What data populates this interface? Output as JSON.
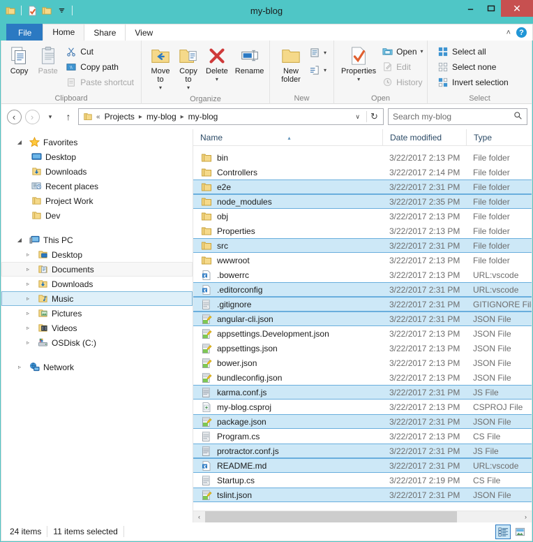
{
  "window": {
    "title": "my-blog",
    "minimize_label": "–",
    "maximize_label": "□",
    "close_label": "✕"
  },
  "quick_access": {
    "items": [
      {
        "name": "folder-icon",
        "label": ""
      },
      {
        "name": "properties-icon",
        "label": ""
      },
      {
        "name": "new-folder-icon",
        "label": ""
      },
      {
        "name": "chevron-down-icon",
        "label": ""
      }
    ]
  },
  "tabs": [
    {
      "label": "File",
      "id": "file"
    },
    {
      "label": "Home",
      "id": "home"
    },
    {
      "label": "Share",
      "id": "share"
    },
    {
      "label": "View",
      "id": "view"
    }
  ],
  "ribbon": {
    "collapse_label": "˄",
    "help_label": "?",
    "groups": [
      {
        "label": "Clipboard",
        "big": [
          {
            "label": "Copy",
            "icon": "copy-icon",
            "disabled": false
          },
          {
            "label": "Paste",
            "icon": "paste-icon",
            "disabled": true
          }
        ],
        "small": [
          {
            "label": "Cut",
            "icon": "cut-icon",
            "disabled": false
          },
          {
            "label": "Copy path",
            "icon": "copy-path-icon",
            "disabled": false
          },
          {
            "label": "Paste shortcut",
            "icon": "paste-shortcut-icon",
            "disabled": true
          }
        ]
      },
      {
        "label": "Organize",
        "big": [
          {
            "label": "Move to",
            "icon": "move-to-icon",
            "dropdown": true
          },
          {
            "label": "Copy to",
            "icon": "copy-to-icon",
            "dropdown": true
          },
          {
            "label": "Delete",
            "icon": "delete-icon",
            "dropdown": true
          },
          {
            "label": "Rename",
            "icon": "rename-icon",
            "dropdown": false
          }
        ],
        "small": []
      },
      {
        "label": "New",
        "big": [
          {
            "label": "New folder",
            "icon": "new-folder-icon",
            "dropdown": false
          }
        ],
        "small": [
          {
            "label": "",
            "icon": "new-item-icon",
            "dropdown": true
          },
          {
            "label": "",
            "icon": "easy-access-icon",
            "dropdown": true
          }
        ]
      },
      {
        "label": "Open",
        "big": [
          {
            "label": "Properties",
            "icon": "properties-icon",
            "dropdown": true
          }
        ],
        "small": [
          {
            "label": "Open",
            "icon": "open-icon",
            "disabled": false,
            "dropdown": true
          },
          {
            "label": "Edit",
            "icon": "edit-icon",
            "disabled": true
          },
          {
            "label": "History",
            "icon": "history-icon",
            "disabled": true
          }
        ]
      },
      {
        "label": "Select",
        "big": [],
        "small": [
          {
            "label": "Select all",
            "icon": "select-all-icon",
            "disabled": false
          },
          {
            "label": "Select none",
            "icon": "select-none-icon",
            "disabled": false
          },
          {
            "label": "Invert selection",
            "icon": "invert-selection-icon",
            "disabled": false
          }
        ]
      }
    ]
  },
  "address": {
    "back_label": "‹",
    "forward_label": "›",
    "recent_label": "▾",
    "up_label": "↑",
    "prefix": "«",
    "crumbs": [
      "Projects",
      "my-blog",
      "my-blog"
    ],
    "separator": "▸",
    "dropdown_label": "∨",
    "refresh_label": "↻"
  },
  "search": {
    "placeholder": "Search my-blog",
    "value": "",
    "icon_label": "⌕"
  },
  "sidebar": {
    "sections": [
      {
        "name": "favorites",
        "root": {
          "label": "Favorites",
          "icon": "star-icon",
          "expander": "◢",
          "state": "expanded",
          "selected": false,
          "hover": false
        },
        "children": [
          {
            "label": "Desktop",
            "icon": "desktop-icon",
            "expander": "",
            "selected": false,
            "hover": false
          },
          {
            "label": "Downloads",
            "icon": "downloads-icon",
            "expander": "",
            "selected": false,
            "hover": false
          },
          {
            "label": "Recent places",
            "icon": "recent-places-icon",
            "expander": "",
            "selected": false,
            "hover": false
          },
          {
            "label": "Project Work",
            "icon": "folder-icon",
            "expander": "",
            "selected": false,
            "hover": false
          },
          {
            "label": "Dev",
            "icon": "folder-icon",
            "expander": "",
            "selected": false,
            "hover": false
          }
        ]
      },
      {
        "name": "this-pc",
        "root": {
          "label": "This PC",
          "icon": "this-pc-icon",
          "expander": "◢",
          "state": "expanded",
          "selected": false,
          "hover": false
        },
        "children": [
          {
            "label": "Desktop",
            "icon": "desktop-folder-icon",
            "expander": "▹",
            "selected": false,
            "hover": false
          },
          {
            "label": "Documents",
            "icon": "documents-icon",
            "expander": "▹",
            "selected": false,
            "hover": true
          },
          {
            "label": "Downloads",
            "icon": "downloads-icon",
            "expander": "▹",
            "selected": false,
            "hover": false
          },
          {
            "label": "Music",
            "icon": "music-icon",
            "expander": "▹",
            "selected": true,
            "hover": false
          },
          {
            "label": "Pictures",
            "icon": "pictures-icon",
            "expander": "▹",
            "selected": false,
            "hover": false
          },
          {
            "label": "Videos",
            "icon": "videos-icon",
            "expander": "▹",
            "selected": false,
            "hover": false
          },
          {
            "label": "OSDisk (C:)",
            "icon": "drive-icon",
            "expander": "▹",
            "selected": false,
            "hover": false
          }
        ]
      },
      {
        "name": "network",
        "root": {
          "label": "Network",
          "icon": "network-icon",
          "expander": "▹",
          "state": "collapsed",
          "selected": false,
          "hover": false
        },
        "children": []
      }
    ]
  },
  "filelist": {
    "columns": [
      {
        "label": "Name",
        "sorted": true,
        "sort_dir": "asc",
        "sort_glyph": "▴"
      },
      {
        "label": "Date modified",
        "sorted": false
      },
      {
        "label": "Type",
        "sorted": false
      }
    ],
    "rows": [
      {
        "name": "bin",
        "date": "3/22/2017 2:13 PM",
        "type": "File folder",
        "icon": "folder-icon",
        "selected": false
      },
      {
        "name": "Controllers",
        "date": "3/22/2017 2:14 PM",
        "type": "File folder",
        "icon": "folder-icon",
        "selected": false
      },
      {
        "name": "e2e",
        "date": "3/22/2017 2:31 PM",
        "type": "File folder",
        "icon": "folder-icon",
        "selected": true
      },
      {
        "name": "node_modules",
        "date": "3/22/2017 2:35 PM",
        "type": "File folder",
        "icon": "folder-icon",
        "selected": true
      },
      {
        "name": "obj",
        "date": "3/22/2017 2:13 PM",
        "type": "File folder",
        "icon": "folder-icon",
        "selected": false
      },
      {
        "name": "Properties",
        "date": "3/22/2017 2:13 PM",
        "type": "File folder",
        "icon": "folder-icon",
        "selected": false
      },
      {
        "name": "src",
        "date": "3/22/2017 2:31 PM",
        "type": "File folder",
        "icon": "folder-icon",
        "selected": true
      },
      {
        "name": "wwwroot",
        "date": "3/22/2017 2:13 PM",
        "type": "File folder",
        "icon": "folder-icon",
        "selected": false
      },
      {
        "name": ".bowerrc",
        "date": "3/22/2017 2:13 PM",
        "type": "URL:vscode",
        "icon": "vscode-file-icon",
        "selected": false
      },
      {
        "name": ".editorconfig",
        "date": "3/22/2017 2:31 PM",
        "type": "URL:vscode",
        "icon": "vscode-file-icon",
        "selected": true
      },
      {
        "name": ".gitignore",
        "date": "3/22/2017 2:31 PM",
        "type": "GITIGNORE File",
        "icon": "text-file-icon",
        "selected": true
      },
      {
        "name": "angular-cli.json",
        "date": "3/22/2017 2:31 PM",
        "type": "JSON File",
        "icon": "json-file-icon",
        "selected": true
      },
      {
        "name": "appsettings.Development.json",
        "date": "3/22/2017 2:13 PM",
        "type": "JSON File",
        "icon": "json-file-icon",
        "selected": false
      },
      {
        "name": "appsettings.json",
        "date": "3/22/2017 2:13 PM",
        "type": "JSON File",
        "icon": "json-file-icon",
        "selected": false
      },
      {
        "name": "bower.json",
        "date": "3/22/2017 2:13 PM",
        "type": "JSON File",
        "icon": "json-file-icon",
        "selected": false
      },
      {
        "name": "bundleconfig.json",
        "date": "3/22/2017 2:13 PM",
        "type": "JSON File",
        "icon": "json-file-icon",
        "selected": false
      },
      {
        "name": "karma.conf.js",
        "date": "3/22/2017 2:31 PM",
        "type": "JS File",
        "icon": "js-file-icon",
        "selected": true
      },
      {
        "name": "my-blog.csproj",
        "date": "3/22/2017 2:13 PM",
        "type": "CSPROJ File",
        "icon": "csproj-file-icon",
        "selected": false
      },
      {
        "name": "package.json",
        "date": "3/22/2017 2:31 PM",
        "type": "JSON File",
        "icon": "json-file-icon",
        "selected": true
      },
      {
        "name": "Program.cs",
        "date": "3/22/2017 2:13 PM",
        "type": "CS File",
        "icon": "text-file-icon",
        "selected": false
      },
      {
        "name": "protractor.conf.js",
        "date": "3/22/2017 2:31 PM",
        "type": "JS File",
        "icon": "js-file-icon",
        "selected": true
      },
      {
        "name": "README.md",
        "date": "3/22/2017 2:31 PM",
        "type": "URL:vscode",
        "icon": "vscode-file-icon",
        "selected": true
      },
      {
        "name": "Startup.cs",
        "date": "3/22/2017 2:19 PM",
        "type": "CS File",
        "icon": "text-file-icon",
        "selected": false
      },
      {
        "name": "tslint.json",
        "date": "3/22/2017 2:31 PM",
        "type": "JSON File",
        "icon": "json-file-icon",
        "selected": true
      }
    ],
    "hscroll": {
      "left_label": "‹",
      "right_label": "›",
      "thumb_percent": 80
    }
  },
  "statusbar": {
    "item_count": "24 items",
    "selection_count": "11 items selected",
    "views": [
      {
        "name": "details-view-button",
        "active": true
      },
      {
        "name": "thumbnails-view-button",
        "active": false
      }
    ]
  },
  "colors": {
    "window_frame": "#4fc6c6",
    "file_tab": "#2b79c2",
    "selection_fill": "#cde8f7",
    "selection_border": "#69aedd",
    "close_button": "#c75050",
    "column_header_text": "#2b4a66"
  }
}
